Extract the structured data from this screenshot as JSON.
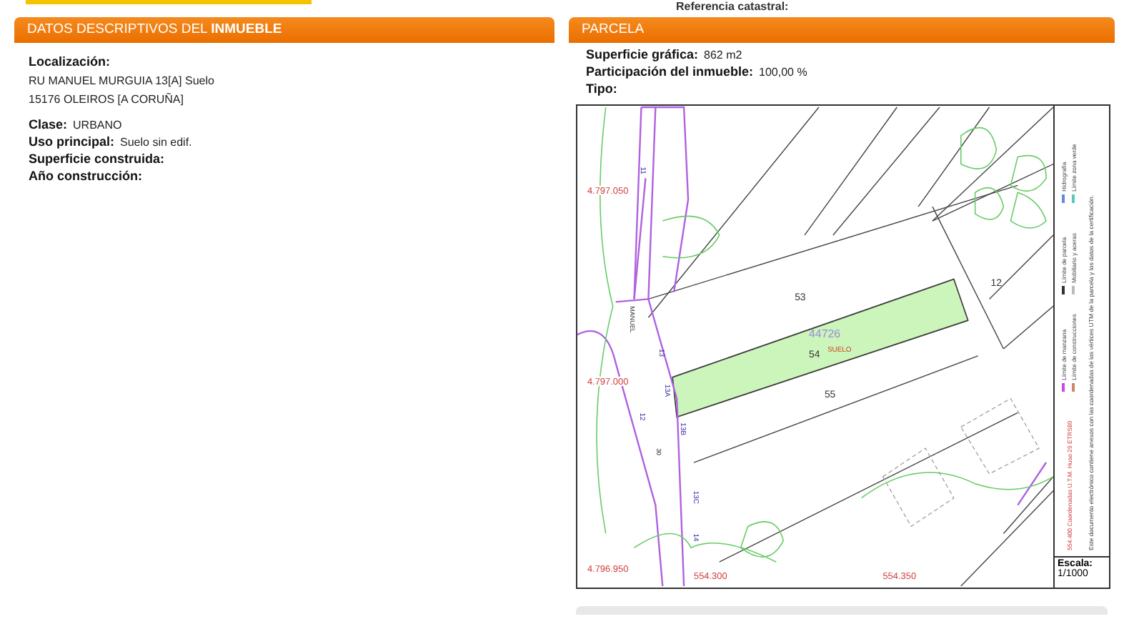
{
  "reference": {
    "label": "Referencia catastral:"
  },
  "descriptive": {
    "title": "DATOS DESCRIPTIVOS DEL **INMUEBLE**",
    "location": {
      "label": "Localización:",
      "lines": [
        "RU MANUEL MURGUIA 13[A] Suelo",
        "15176 OLEIROS [A CORUÑA]"
      ]
    },
    "fields": [
      {
        "label": "Clase:",
        "value": "URBANO"
      },
      {
        "label": "Uso principal:",
        "value": "Suelo sin edif."
      },
      {
        "label": "Superficie construida:"
      },
      {
        "label": "Año construcción:"
      }
    ]
  },
  "parcel": {
    "title": "PARCELA",
    "fields": [
      {
        "label": "Superficie gráfica:",
        "value": "862 m2"
      },
      {
        "label": "Participación del inmueble:",
        "value": "100,00 %"
      },
      {
        "label": "Tipo:"
      }
    ],
    "map": {
      "labels": [
        {
          "text": "53",
          "kind": "parcel"
        },
        {
          "text": "44726",
          "kind": "block"
        },
        {
          "text": "54",
          "kind": "parcel"
        },
        {
          "text": "SUELO",
          "kind": "use"
        },
        {
          "text": "55",
          "kind": "parcel"
        },
        {
          "text": "12",
          "kind": "parcel"
        },
        {
          "text": "4.797.050",
          "kind": "coord"
        },
        {
          "text": "4.797.000",
          "kind": "coord"
        },
        {
          "text": "4.796.950",
          "kind": "coord"
        },
        {
          "text": "554.300",
          "kind": "coord"
        },
        {
          "text": "554.350",
          "kind": "coord"
        },
        {
          "text": "MANUEL",
          "kind": "street"
        },
        {
          "text": "13",
          "kind": "number"
        },
        {
          "text": "13A",
          "kind": "number"
        },
        {
          "text": "13B",
          "kind": "number"
        },
        {
          "text": "13C",
          "kind": "number"
        },
        {
          "text": "12",
          "kind": "number"
        },
        {
          "text": "30",
          "kind": "street"
        },
        {
          "text": "14",
          "kind": "number"
        },
        {
          "text": "11",
          "kind": "number"
        }
      ],
      "legend": [
        {
          "label": "Límite de manzana",
          "color": "#cc44ee"
        },
        {
          "label": "Límite de parcela",
          "color": "#333333"
        },
        {
          "label": "Hidrografía",
          "color": "#6688dd"
        },
        {
          "label": "Límite de construcciones",
          "color": "#cc8866"
        },
        {
          "label": "Mobiliario y aceras",
          "color": "#bbbbbb"
        },
        {
          "label": "Límite zona verde",
          "color": "#55ccbb"
        }
      ],
      "coordinates": "554.400 Coordenadas U.T.M. Huso 29 ETRS89",
      "note": "Este documento electrónico contiene anexos con las coordenadas de los vértices UTM de la parcela y los datos de la certificación.",
      "scale": {
        "label": "Escala:",
        "value": "1/1000"
      }
    }
  }
}
